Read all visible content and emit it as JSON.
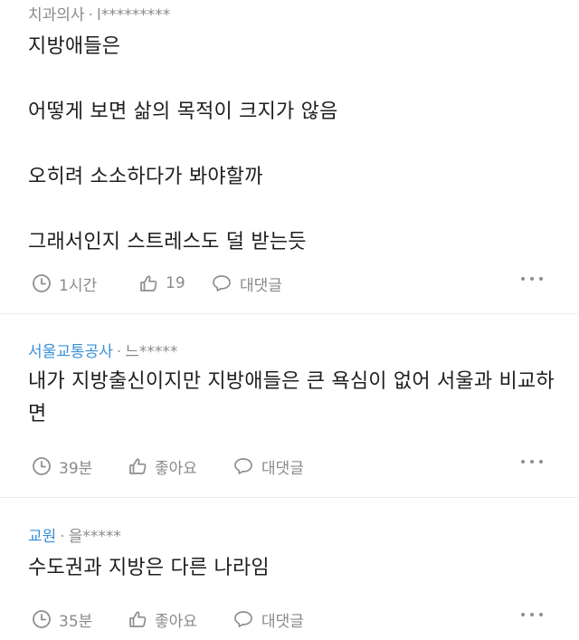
{
  "comments": [
    {
      "company": "치과의사",
      "separator": "·",
      "nickname": "l*********",
      "text": "지방애들은\n\n어떻게 보면 삶의 목적이 크지가 않음\n\n오히려 소소하다가 봐야할까\n\n그래서인지 스트레스도 덜 받는듯",
      "time": "1시간",
      "like_label": "19",
      "reply_label": "대댓글",
      "company_color": "#8a8a8a"
    },
    {
      "company": "서울교통공사",
      "separator": "·",
      "nickname": "느*****",
      "text": "내가 지방출신이지만 지방애들은 큰 욕심이 없어 서울과 비교하면",
      "time": "39분",
      "like_label": "좋아요",
      "reply_label": "대댓글",
      "company_color": "#3a8fd8"
    },
    {
      "company": "교원",
      "separator": "·",
      "nickname": "을*****",
      "text": "수도권과 지방은 다른 나라임",
      "time": "35분",
      "like_label": "좋아요",
      "reply_label": "대댓글",
      "company_color": "#3a8fd8"
    }
  ],
  "icons": {
    "time": "clock-icon",
    "like": "thumbs-up-icon",
    "reply": "speech-bubble-icon",
    "more": "more-dots-icon"
  }
}
